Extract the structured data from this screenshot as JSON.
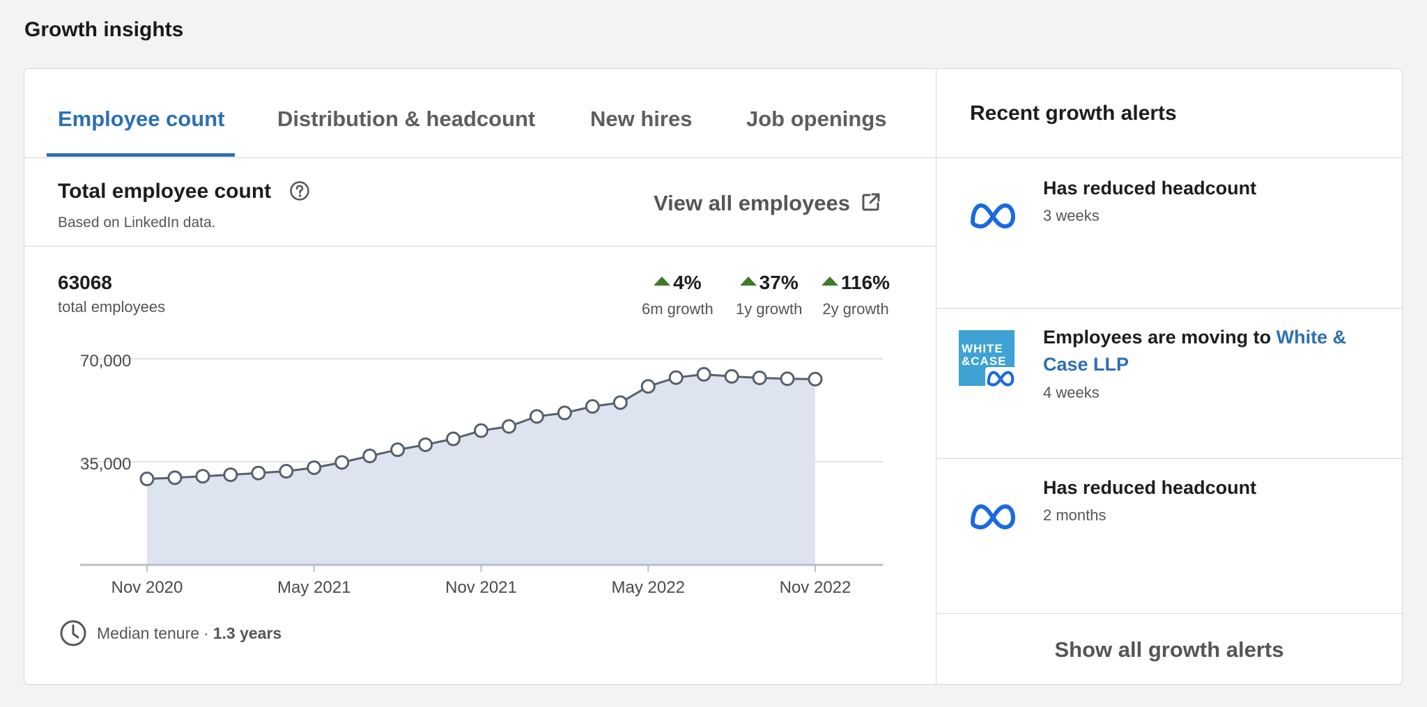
{
  "section_title": "Growth insights",
  "tabs": [
    {
      "label": "Employee count",
      "active": true
    },
    {
      "label": "Distribution & headcount",
      "active": false
    },
    {
      "label": "New hires",
      "active": false
    },
    {
      "label": "Job openings",
      "active": false
    }
  ],
  "header": {
    "title": "Total employee count",
    "subtitle": "Based on LinkedIn data.",
    "view_all": "View all employees"
  },
  "stats": {
    "total": "63068",
    "total_label": "total employees",
    "growth": [
      {
        "value": "4%",
        "label": "6m growth"
      },
      {
        "value": "37%",
        "label": "1y growth"
      },
      {
        "value": "116%",
        "label": "2y growth"
      }
    ]
  },
  "tenure": {
    "label": "Median tenure",
    "separator": "·",
    "value": "1.3 years"
  },
  "alerts": {
    "title": "Recent growth alerts",
    "items": [
      {
        "title": "Has reduced headcount",
        "link": "",
        "time": "3 weeks",
        "logo": "meta-logo-icon"
      },
      {
        "title": "Employees are moving to ",
        "link": "White & Case LLP",
        "time": "4 weeks",
        "logo": "white-case-logo"
      },
      {
        "title": "Has reduced headcount",
        "link": "",
        "time": "2 months",
        "logo": "meta-logo-icon"
      }
    ],
    "show_all": "Show all growth alerts",
    "white_case_logo_text": "WHITE &CASE"
  },
  "colors": {
    "accent": "#2d6fb3",
    "growth_up": "#3f7a27",
    "area_fill": "#dde4ef",
    "line": "#56606d",
    "meta_blue": "#1a6ae0"
  },
  "chart_data": {
    "type": "area",
    "x": [
      "Nov 2020",
      "Dec 2020",
      "Jan 2021",
      "Feb 2021",
      "Mar 2021",
      "Apr 2021",
      "May 2021",
      "Jun 2021",
      "Jul 2021",
      "Aug 2021",
      "Sep 2021",
      "Oct 2021",
      "Nov 2021",
      "Dec 2021",
      "Jan 2022",
      "Feb 2022",
      "Mar 2022",
      "Apr 2022",
      "May 2022",
      "Jun 2022",
      "Jul 2022",
      "Aug 2022",
      "Sep 2022",
      "Oct 2022",
      "Nov 2022"
    ],
    "values": [
      29200,
      29600,
      30100,
      30600,
      31200,
      31800,
      33000,
      34800,
      37000,
      39100,
      40800,
      42800,
      45600,
      47000,
      50400,
      51600,
      53800,
      55100,
      60600,
      63600,
      64700,
      64000,
      63500,
      63200,
      63068
    ],
    "xticks": [
      "Nov 2020",
      "May 2021",
      "Nov 2021",
      "May 2022",
      "Nov 2022"
    ],
    "yticks": [
      35000,
      70000
    ],
    "ytick_labels": [
      "35,000",
      "70,000"
    ],
    "ylim": [
      0,
      70000
    ],
    "grid": true
  }
}
